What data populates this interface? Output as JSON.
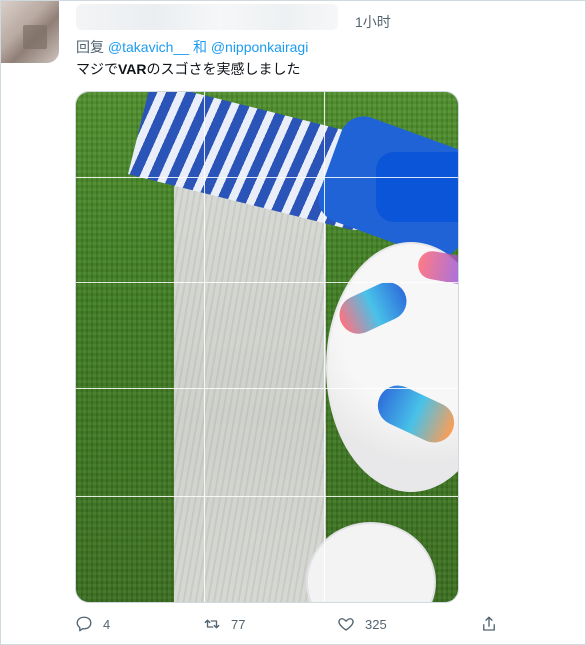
{
  "tweet": {
    "timestamp": "1小时",
    "reply_prefix": "回复",
    "reply_handle_1": "@takavich__",
    "reply_handle_2": "和 @nipponkairagi",
    "text_before": "マジで",
    "text_bold": "VAR",
    "text_after": "のスゴさを実感しました"
  },
  "actions": {
    "reply_count": "4",
    "retweet_count": "77",
    "like_count": "325"
  },
  "icons": {
    "reply": "reply-icon",
    "retweet": "retweet-icon",
    "like": "heart-icon",
    "share": "share-icon"
  },
  "colors": {
    "accent": "#1d9bf0",
    "muted": "#536471",
    "text": "#0f1419"
  }
}
